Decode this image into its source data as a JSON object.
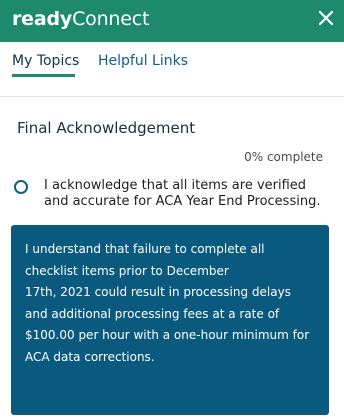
{
  "header": {
    "brand_bold": "ready",
    "brand_light": "Connect",
    "close_icon": "close-x-icon"
  },
  "tabs": [
    {
      "label": "My Topics",
      "active": true
    },
    {
      "label": "Helpful Links",
      "active": false
    }
  ],
  "section": {
    "title": "Final Acknowledgement",
    "progress_text": "0% complete",
    "progress_value": 0
  },
  "acknowledgement": {
    "checked": false,
    "text": "I acknowledge that all items are verified and accurate for ACA Year End Processing."
  },
  "notice": {
    "lines": [
      "I understand that failure to complete all",
      "checklist items prior to December",
      "17th, 2021 could result in processing delays",
      "and additional processing fees at a rate of",
      "$100.00 per hour with a one-hour minimum for",
      "ACA data corrections."
    ]
  },
  "colors": {
    "header_bg": "#1c8a6b",
    "notice_bg": "#0a5a80",
    "link": "#0d5f86"
  }
}
